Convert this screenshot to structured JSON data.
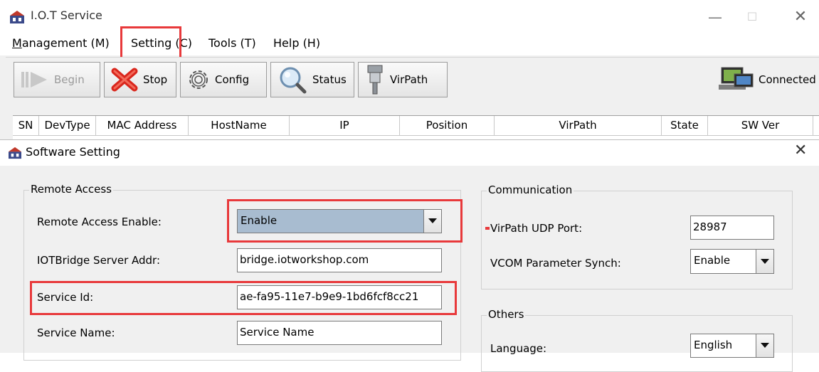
{
  "window": {
    "title": "I.O.T Service",
    "controls": {
      "minimize": "—",
      "maximize": "☐",
      "close": "✕"
    }
  },
  "menu": {
    "items": [
      {
        "label": "Management (M)",
        "hotkey": "M"
      },
      {
        "label": "Setting (C)",
        "hotkey": ""
      },
      {
        "label": "Tools (T)",
        "hotkey": ""
      },
      {
        "label": "Help (H)",
        "hotkey": ""
      }
    ]
  },
  "toolbar": {
    "begin": "Begin",
    "stop": "Stop",
    "config": "Config",
    "status": "Status",
    "virpath": "VirPath",
    "connected": "Connected"
  },
  "grid": {
    "columns": [
      "SN",
      "DevType",
      "MAC Address",
      "HostName",
      "IP",
      "Position",
      "VirPath",
      "State",
      "SW Ver"
    ]
  },
  "dialog": {
    "title": "Software Setting",
    "close": "✕",
    "remote_access": {
      "legend": "Remote Access",
      "enable_label": "Remote Access Enable:",
      "enable_value": "Enable",
      "server_label": "IOTBridge Server Addr:",
      "server_value": "bridge.iotworkshop.com",
      "service_id_label": "Service Id:",
      "service_id_value": "ae-fa95-11e7-b9e9-1bd6fcf8cc21",
      "service_name_label": "Service Name:",
      "service_name_value": "Service Name"
    },
    "communication": {
      "legend": "Communication",
      "udp_port_label": "VirPath UDP Port:",
      "udp_port_value": "28987",
      "vcom_label": "VCOM Parameter Synch:",
      "vcom_value": "Enable"
    },
    "others": {
      "legend": "Others",
      "language_label": "Language:",
      "language_value": "English"
    }
  },
  "colors": {
    "highlight": "#e8393b",
    "selected_combo": "#a8bcd0"
  }
}
